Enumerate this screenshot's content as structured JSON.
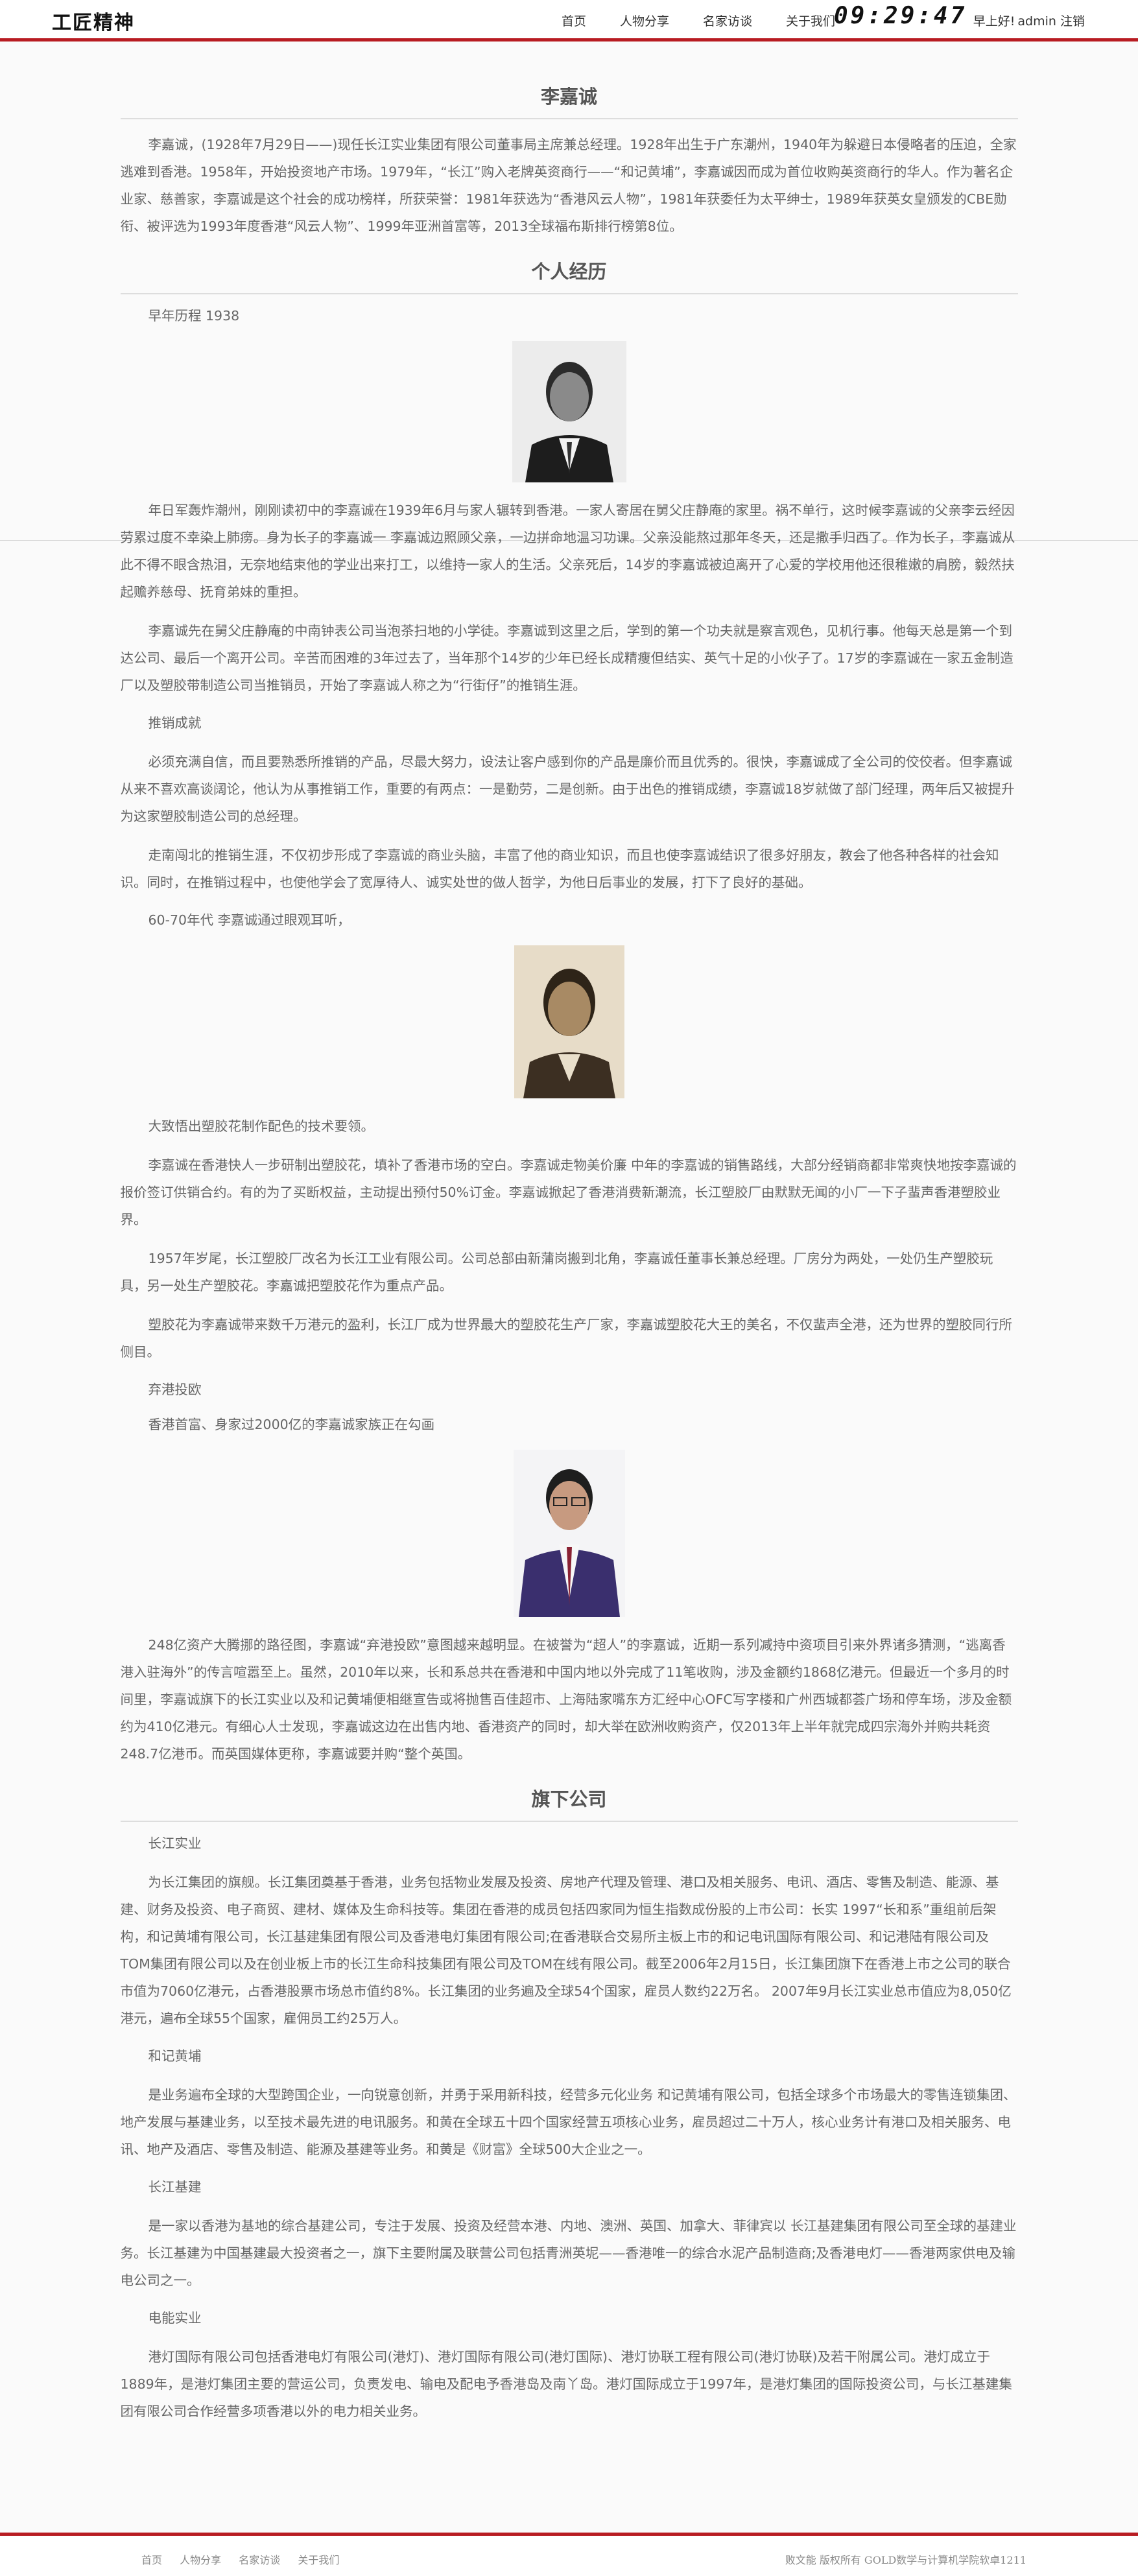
{
  "header": {
    "logo": "工匠精神",
    "nav": [
      "首页",
      "人物分享",
      "名家访谈",
      "关于我们"
    ],
    "clock": "09:29:47",
    "greeting": "早上好!",
    "user": "admin",
    "logout": "注销"
  },
  "sections": {
    "bio_title": "李嘉诚",
    "bio_intro": "李嘉诚，(1928年7月29日——)现任长江实业集团有限公司董事局主席兼总经理。1928年出生于广东潮州，1940年为躲避日本侵略者的压迫，全家逃难到香港。1958年，开始投资地产市场。1979年，“长江”购入老牌英资商行——“和记黄埔”，李嘉诚因而成为首位收购英资商行的华人。作为著名企业家、慈善家，李嘉诚是这个社会的成功榜样，所获荣誉：1981年获选为“香港风云人物”，1981年获委任为太平绅士，1989年获英女皇颁发的CBE勋衔、被评选为1993年度香港“风云人物”、1999年亚洲首富等，2013全球福布斯排行榜第8位。",
    "history_title": "个人经历",
    "early_label": "早年历程 1938",
    "early_p1": "年日军轰炸潮州，刚刚读初中的李嘉诚在1939年6月与家人辗转到香港。一家人寄居在舅父庄静庵的家里。祸不单行，这时候李嘉诚的父亲李云经因劳累过度不幸染上肺痨。身为长子的李嘉诚一 李嘉诚边照顾父亲，一边拼命地温习功课。父亲没能熬过那年冬天，还是撒手归西了。作为长子，李嘉诚从此不得不眼含热泪，无奈地结束他的学业出来打工，以维持一家人的生活。父亲死后，14岁的李嘉诚被迫离开了心爱的学校用他还很稚嫩的肩膀，毅然扶起赡养慈母、抚育弟妹的重担。",
    "early_p2": "李嘉诚先在舅父庄静庵的中南钟表公司当泡茶扫地的小学徒。李嘉诚到这里之后，学到的第一个功夫就是察言观色，见机行事。他每天总是第一个到达公司、最后一个离开公司。辛苦而困难的3年过去了，当年那个14岁的少年已经长成精瘦但结实、英气十足的小伙子了。17岁的李嘉诚在一家五金制造厂以及塑胶带制造公司当推销员，开始了李嘉诚人称之为“行街仔”的推销生涯。",
    "sales_label": "推销成就",
    "sales_p1": "必须充满自信，而且要熟悉所推销的产品，尽最大努力，设法让客户感到你的产品是廉价而且优秀的。很快，李嘉诚成了全公司的佼佼者。但李嘉诚从来不喜欢高谈阔论，他认为从事推销工作，重要的有两点：一是勤劳，二是创新。由于出色的推销成绩，李嘉诚18岁就做了部门经理，两年后又被提升为这家塑胶制造公司的总经理。",
    "sales_p2": "走南闯北的推销生涯，不仅初步形成了李嘉诚的商业头脑，丰富了他的商业知识，而且也使李嘉诚结识了很多好朋友，教会了他各种各样的社会知识。同时，在推销过程中，也使他学会了宽厚待人、诚实处世的做人哲学，为他日后事业的发展，打下了良好的基础。",
    "era_label": "60-70年代 李嘉诚通过眼观耳听，",
    "era_label2": "大致悟出塑胶花制作配色的技术要领。",
    "era_p1": "李嘉诚在香港快人一步研制出塑胶花，填补了香港市场的空白。李嘉诚走物美价廉 中年的李嘉诚的销售路线，大部分经销商都非常爽快地按李嘉诚的报价签订供销合约。有的为了买断权益，主动提出预付50%订金。李嘉诚掀起了香港消费新潮流，长江塑胶厂由默默无闻的小厂一下子蜚声香港塑胶业界。",
    "era_p2": "1957年岁尾，长江塑胶厂改名为长江工业有限公司。公司总部由新蒲岗搬到北角，李嘉诚任董事长兼总经理。厂房分为两处，一处仍生产塑胶玩具，另一处生产塑胶花。李嘉诚把塑胶花作为重点产品。",
    "era_p3": "塑胶花为李嘉诚带来数千万港元的盈利，长江厂成为世界最大的塑胶花生产厂家，李嘉诚塑胶花大王的美名，不仅蜚声全港，还为世界的塑胶同行所侧目。",
    "abandon_label": "弃港投欧",
    "abandon_label2": "香港首富、身家过2000亿的李嘉诚家族正在勾画",
    "abandon_p1": "248亿资产大腾挪的路径图，李嘉诚“弃港投欧”意图越来越明显。在被誉为“超人”的李嘉诚，近期一系列减持中资项目引来外界诸多猜测，“逃离香港入驻海外”的传言喧嚣至上。虽然，2010年以来，长和系总共在香港和中国内地以外完成了11笔收购，涉及金额约1868亿港元。但最近一个多月的时间里，李嘉诚旗下的长江实业以及和记黄埔便相继宣告或将抛售百佳超市、上海陆家嘴东方汇经中心OFC写字楼和广州西城都荟广场和停车场，涉及金额约为410亿港元。有细心人士发现，李嘉诚这边在出售内地、香港资产的同时，却大举在欧洲收购资产，仅2013年上半年就完成四宗海外并购共耗资248.7亿港币。而英国媒体更称，李嘉诚要并购“整个英国。",
    "companies_title": "旗下公司",
    "c1_label": "长江实业",
    "c1_p": "为长江集团的旗舰。长江集团奠基于香港，业务包括物业发展及投资、房地产代理及管理、港口及相关服务、电讯、酒店、零售及制造、能源、基建、财务及投资、电子商贸、建材、媒体及生命科技等。集团在香港的成员包括四家同为恒生指数成份股的上市公司：长实 1997“长和系”重组前后架构，和记黄埔有限公司，长江基建集团有限公司及香港电灯集团有限公司;在香港联合交易所主板上市的和记电讯国际有限公司、和记港陆有限公司及TOM集团有限公司以及在创业板上市的长江生命科技集团有限公司及TOM在线有限公司。截至2006年2月15日，长江集团旗下在香港上市之公司的联合市值为7060亿港元，占香港股票市场总市值约8%。长江集团的业务遍及全球54个国家，雇员人数约22万名。 2007年9月长江实业总市值应为8,050亿港元，遍布全球55个国家，雇佣员工约25万人。",
    "c2_label": "和记黄埔",
    "c2_p": "是业务遍布全球的大型跨国企业，一向锐意创新，并勇于采用新科技，经营多元化业务 和记黄埔有限公司，包括全球多个市场最大的零售连锁集团、地产发展与基建业务，以至技术最先进的电讯服务。和黄在全球五十四个国家经营五项核心业务，雇员超过二十万人，核心业务计有港口及相关服务、电讯、地产及酒店、零售及制造、能源及基建等业务。和黄是《财富》全球500大企业之一。",
    "c3_label": "长江基建",
    "c3_p": "是一家以香港为基地的综合基建公司，专注于发展、投资及经营本港、内地、澳洲、英国、加拿大、菲律宾以 长江基建集团有限公司至全球的基建业务。长江基建为中国基建最大投资者之一，旗下主要附属及联营公司包括青洲英坭——香港唯一的综合水泥产品制造商;及香港电灯——香港两家供电及输电公司之一。",
    "c4_label": "电能实业",
    "c4_p": "港灯国际有限公司包括香港电灯有限公司(港灯)、港灯国际有限公司(港灯国际)、港灯协联工程有限公司(港灯协联)及若干附属公司。港灯成立于1889年，是港灯集团主要的营运公司，负责发电、输电及配电予香港岛及南丫岛。港灯国际成立于1997年，是港灯集团的国际投资公司，与长江基建集团有限公司合作经营多项香港以外的电力相关业务。"
  },
  "footer": {
    "links": [
      "首页",
      "人物分享",
      "名家访谈",
      "关于我们"
    ],
    "copyright": "败文能  版权所有  GOLD数学与计算机学院软卓1211"
  },
  "colors": {
    "accent": "#b81c22",
    "text": "#666666",
    "background": "#fafafa"
  }
}
